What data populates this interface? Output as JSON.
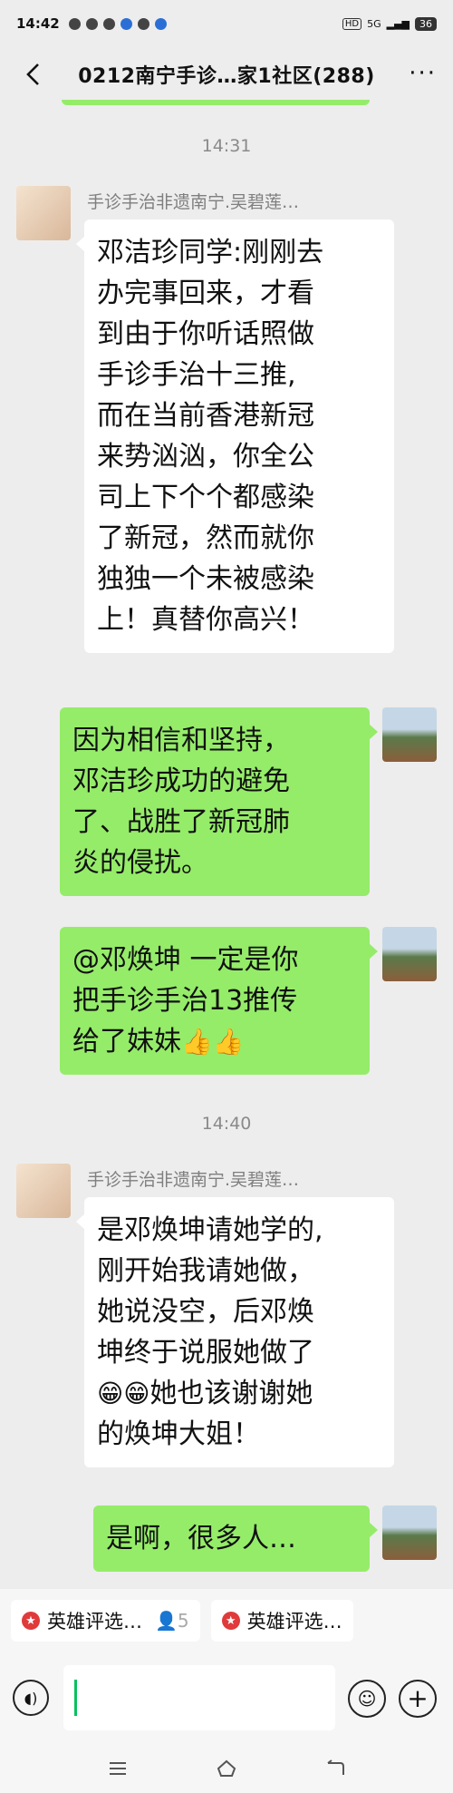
{
  "status": {
    "time": "14:42",
    "network": "5G",
    "battery": "36",
    "hd": "HD"
  },
  "header": {
    "title": "0212南宁手诊…家1社区(288)",
    "more": "···"
  },
  "messages": {
    "time1": "14:31",
    "m1": {
      "sender": "手诊手治非遗南宁.吴碧莲…",
      "lines": [
        "邓洁珍同学:刚刚去",
        "办完事回来，才看",
        "到由于你听话照做",
        "手诊手治十三推,",
        "而在当前香港新冠",
        "来势汹汹，你全公",
        "司上下个个都感染",
        "了新冠，然而就你",
        "独独一个未被感染",
        "上！真替你高兴！"
      ]
    },
    "m2": {
      "lines": [
        "因为相信和坚持，",
        "邓洁珍成功的避免",
        "了、战胜了新冠肺",
        "炎的侵扰。"
      ]
    },
    "m3": {
      "lines": [
        "@邓焕坤  一定是你",
        "把手诊手治13推传",
        "给了妹妹"
      ],
      "emoji": "👍👍"
    },
    "time2": "14:40",
    "m4": {
      "sender": "手诊手治非遗南宁.吴碧莲…",
      "lines": [
        "是邓焕坤请她学的,",
        "刚开始我请她做，",
        "她说没空，后邓焕",
        "坤终于说服她做了"
      ],
      "line5_emoji": "😁😁",
      "line5_text": "她也该谢谢她",
      "line6": "的焕坤大姐！"
    },
    "m5": {
      "text": "是啊，很多人…"
    }
  },
  "tags": [
    {
      "label": "英雄评选…",
      "count": "5"
    },
    {
      "label": "英雄评选…"
    }
  ],
  "colors": {
    "background": "#ededed",
    "bubble_self": "#95ec69",
    "bubble_other": "#ffffff",
    "cursor": "#07c160"
  }
}
